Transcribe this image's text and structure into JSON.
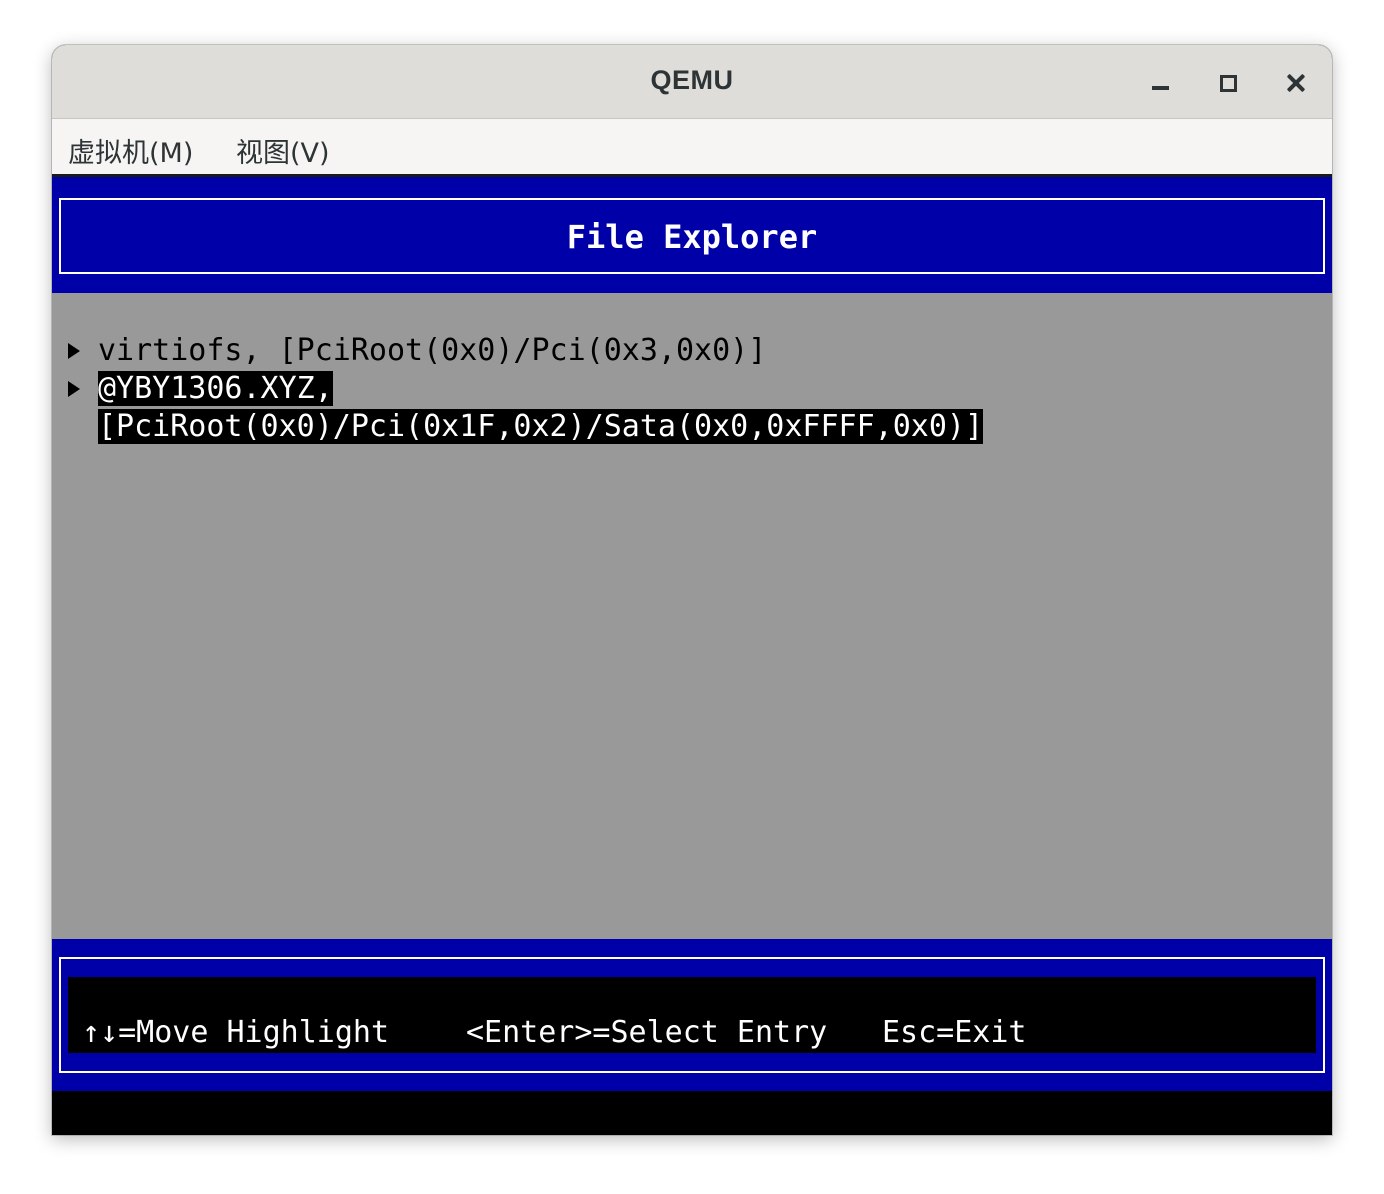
{
  "window": {
    "title": "QEMU"
  },
  "menubar": {
    "items": [
      {
        "label": "虚拟机(M)"
      },
      {
        "label": "视图(V)"
      }
    ]
  },
  "screen": {
    "header_title": "File Explorer",
    "entries": [
      {
        "line1": "virtiofs, [PciRoot(0x0)/Pci(0x3,0x0)]",
        "highlighted": false
      },
      {
        "line1": "@YBY1306.XYZ,",
        "line2": "[PciRoot(0x0)/Pci(0x1F,0x2)/Sata(0x0,0xFFFF,0x0)]",
        "highlighted": true
      }
    ],
    "footer": {
      "move": "↑↓=Move Highlight",
      "select": "<Enter>=Select Entry",
      "exit": "Esc=Exit"
    }
  },
  "colors": {
    "bios_blue": "#0000a8",
    "bios_gray": "#999999",
    "titlebar": "#deddda",
    "menubar": "#f6f5f4"
  },
  "icons": [
    "minimize-icon",
    "maximize-icon",
    "close-icon",
    "submenu-arrow-icon"
  ]
}
